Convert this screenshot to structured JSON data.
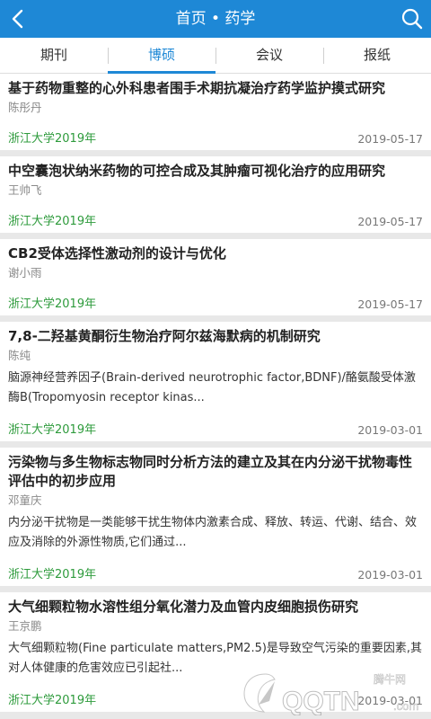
{
  "header": {
    "title": "首页 • 药学",
    "back_icon": "chevron-left-icon",
    "search_icon": "search-icon"
  },
  "tabs": [
    {
      "label": "期刊",
      "active": false
    },
    {
      "label": "博硕",
      "active": true
    },
    {
      "label": "会议",
      "active": false
    },
    {
      "label": "报纸",
      "active": false
    }
  ],
  "items": [
    {
      "title": "基于药物重整的心外科患者围手术期抗凝治疗药学监护摸式研究",
      "author": "陈彤丹",
      "abstract": "",
      "source": "浙江大学2019年",
      "date": "2019-05-17"
    },
    {
      "title": "中空囊泡状纳米药物的可控合成及其肿瘤可视化治疗的应用研究",
      "author": "王帅飞",
      "abstract": "",
      "source": "浙江大学2019年",
      "date": "2019-05-17"
    },
    {
      "title": "CB2受体选择性激动剂的设计与优化",
      "author": "谢小雨",
      "abstract": "",
      "source": "浙江大学2019年",
      "date": "2019-05-17"
    },
    {
      "title": "7,8-二羟基黄酮衍生物治疗阿尔兹海默病的机制研究",
      "author": "陈纯",
      "abstract": "脑源神经营养因子(Brain-derived neurotrophic factor,BDNF)/酪氨酸受体激酶B(Tropomyosin receptor kinas...",
      "source": "浙江大学2019年",
      "date": "2019-03-01"
    },
    {
      "title": "污染物与多生物标志物同时分析方法的建立及其在内分泌干扰物毒性评估中的初步应用",
      "author": "邓童庆",
      "abstract": "内分泌干扰物是一类能够干扰生物体内激素合成、释放、转运、代谢、结合、效应及消除的外源性物质,它们通过...",
      "source": "浙江大学2019年",
      "date": "2019-03-01"
    },
    {
      "title": "大气细颗粒物水溶性组分氧化潜力及血管内皮细胞损伤研究",
      "author": "王京鹏",
      "abstract": "大气细颗粒物(Fine particulate matters,PM2.5)是导致空气污染的重要因素,其对人体健康的危害效应已引起社...",
      "source": "浙江大学2019年",
      "date": "2019-03-01"
    }
  ],
  "watermark": {
    "brand_cn": "腾牛网",
    "brand_en": "QQTN",
    "domain": ".com"
  },
  "colors": {
    "accent": "#1e88d6",
    "source_green": "#2e9b3c"
  }
}
